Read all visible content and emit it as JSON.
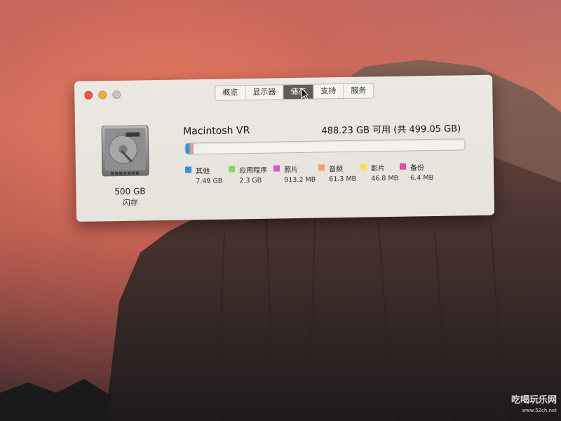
{
  "toolbar": {
    "tabs": [
      {
        "label": "概览"
      },
      {
        "label": "显示器"
      },
      {
        "label": "储存",
        "active": true
      },
      {
        "label": "支持"
      },
      {
        "label": "服务"
      }
    ]
  },
  "disk": {
    "size": "500 GB",
    "type": "闪存"
  },
  "volume": {
    "name": "Macintosh VR",
    "capacity": "488.23 GB 可用 (共 499.05 GB)",
    "usage_fraction": 0.022
  },
  "legend": [
    {
      "label": "其他",
      "value": "7.49 GB",
      "color": "#3b8fd9"
    },
    {
      "label": "应用程序",
      "value": "2.3 GB",
      "color": "#86d46a"
    },
    {
      "label": "照片",
      "value": "913.2 MB",
      "color": "#d85bd1"
    },
    {
      "label": "音频",
      "value": "61.3 MB",
      "color": "#f0a068"
    },
    {
      "label": "影片",
      "value": "46.8 MB",
      "color": "#f0e05a"
    },
    {
      "label": "备份",
      "value": "6.4 MB",
      "color": "#e04aa8"
    }
  ],
  "watermark": {
    "text": "吃喝玩乐网",
    "url": "www.52ch.net"
  }
}
